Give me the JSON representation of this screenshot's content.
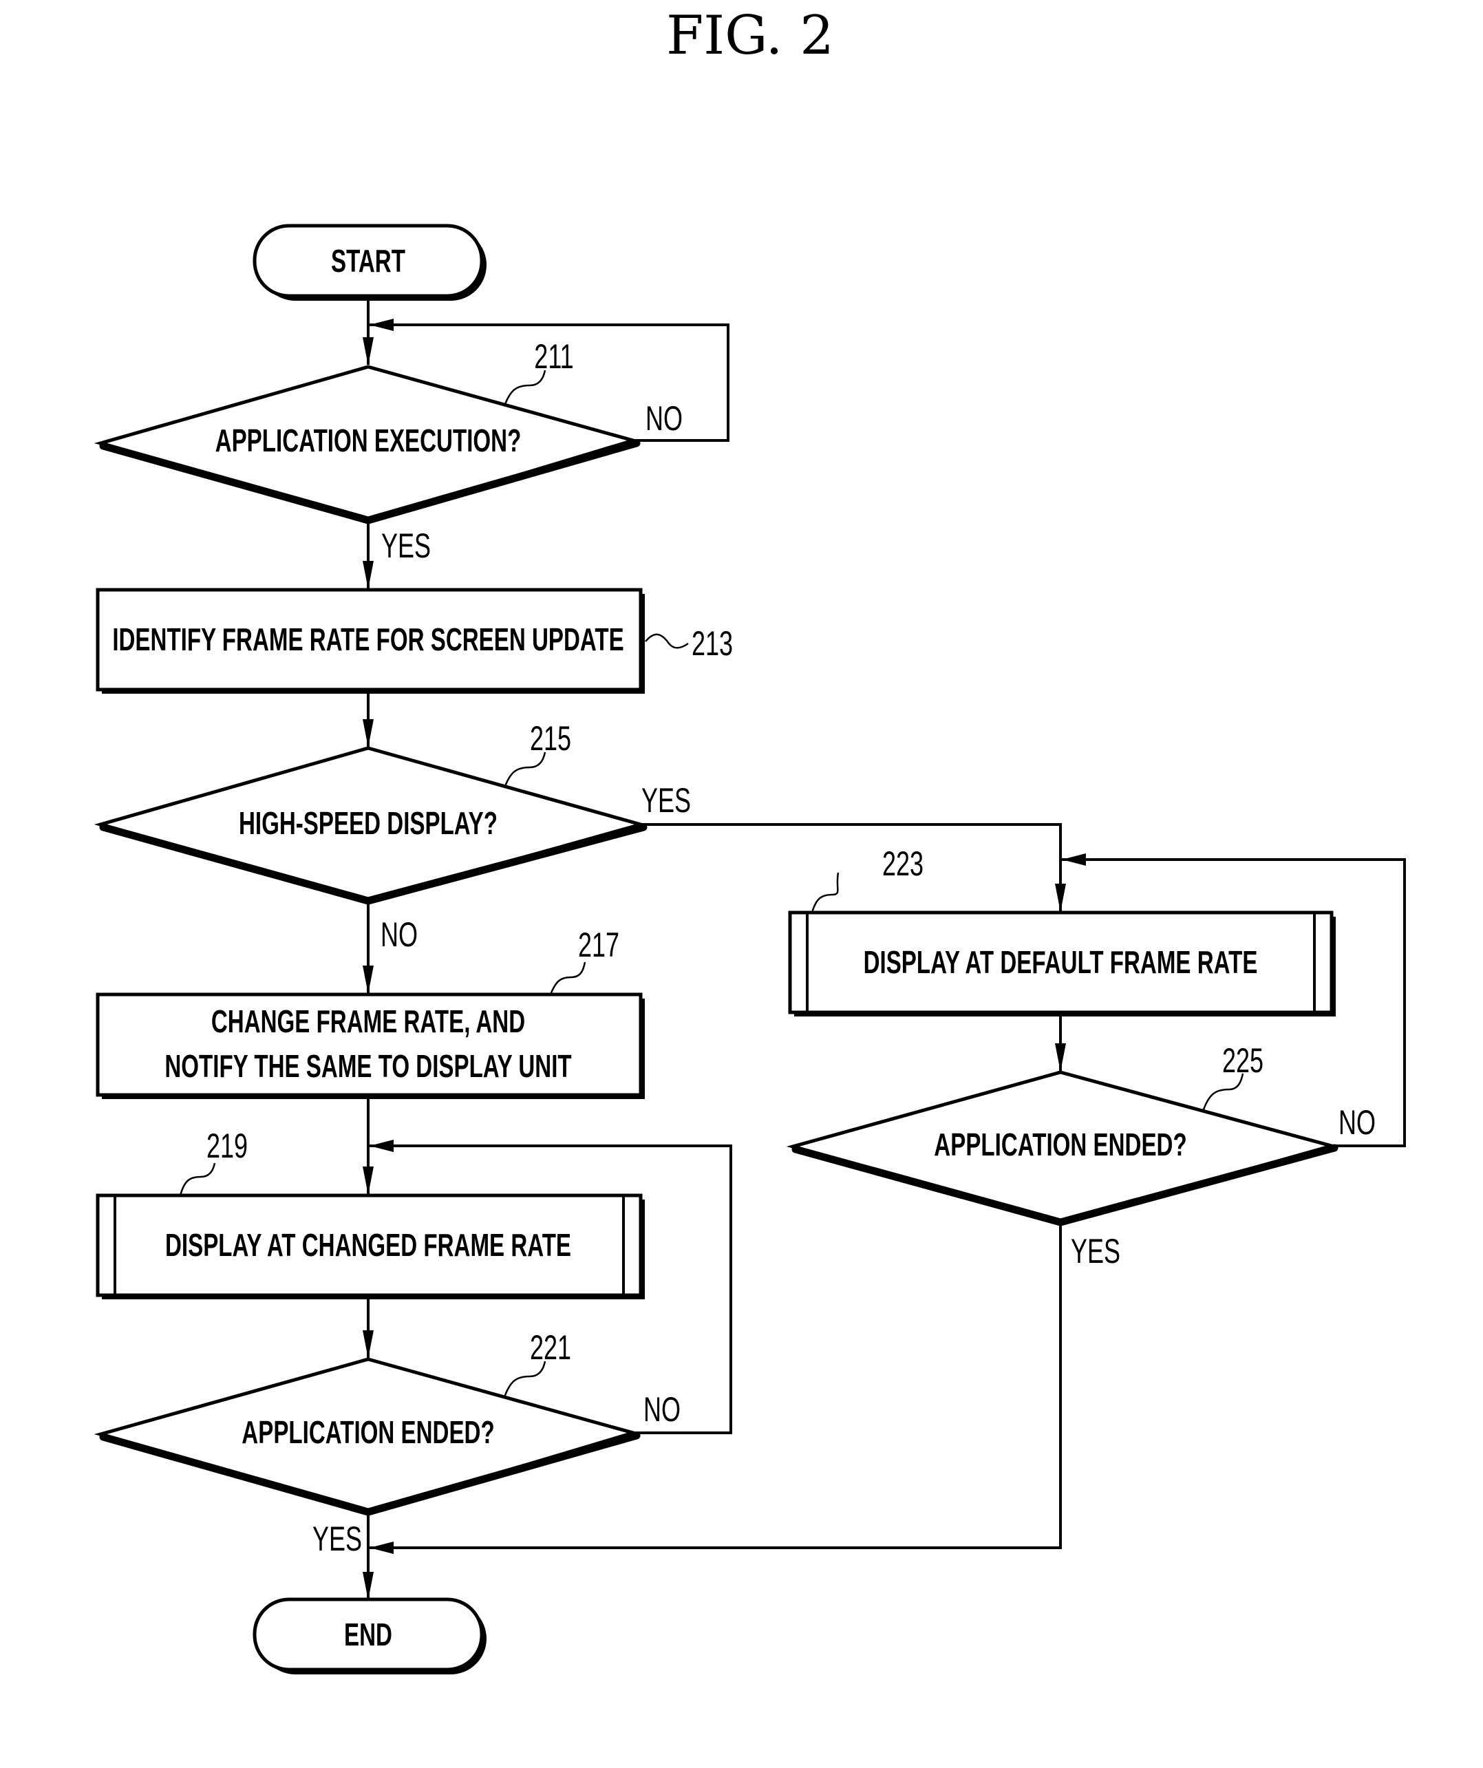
{
  "figure": {
    "title": "FIG. 2"
  },
  "nodes": {
    "start": {
      "label": "START"
    },
    "n211": {
      "ref": "211",
      "lines": [
        "APPLICATION EXECUTION?"
      ],
      "yes": "YES",
      "no": "NO"
    },
    "n213": {
      "ref": "213",
      "lines": [
        "IDENTIFY FRAME RATE FOR SCREEN UPDATE"
      ]
    },
    "n215": {
      "ref": "215",
      "lines": [
        "HIGH-SPEED DISPLAY?"
      ],
      "yes": "YES",
      "no": "NO"
    },
    "n217": {
      "ref": "217",
      "lines": [
        "CHANGE FRAME RATE, AND",
        "NOTIFY THE SAME TO DISPLAY UNIT"
      ]
    },
    "n219": {
      "ref": "219",
      "lines": [
        "DISPLAY AT CHANGED FRAME RATE"
      ]
    },
    "n221": {
      "ref": "221",
      "lines": [
        "APPLICATION ENDED?"
      ],
      "yes": "YES",
      "no": "NO"
    },
    "n223": {
      "ref": "223",
      "lines": [
        "DISPLAY AT DEFAULT FRAME RATE"
      ]
    },
    "n225": {
      "ref": "225",
      "lines": [
        "APPLICATION ENDED?"
      ],
      "yes": "YES",
      "no": "NO"
    },
    "end": {
      "label": "END"
    }
  }
}
